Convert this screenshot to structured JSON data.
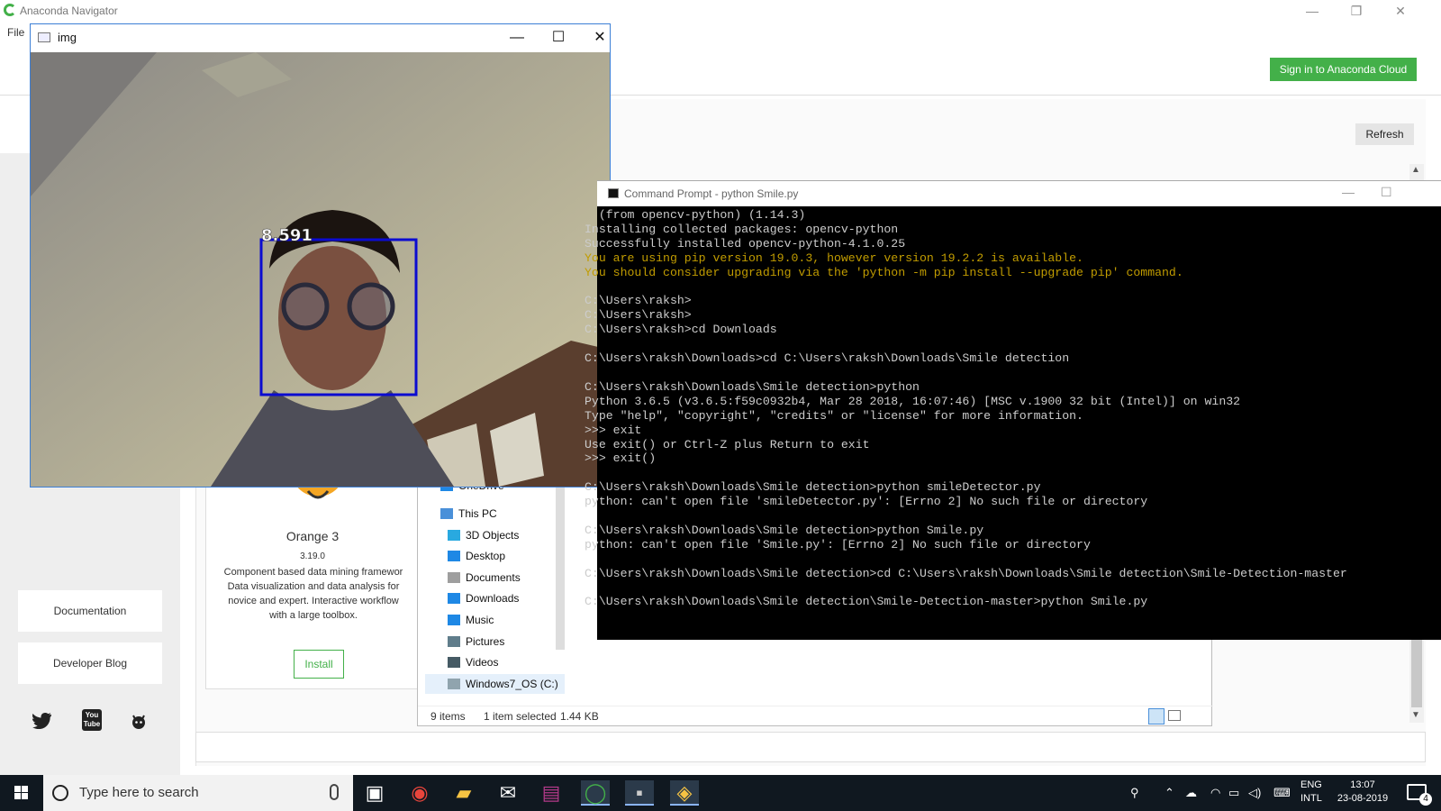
{
  "navigator": {
    "title": "Anaconda Navigator",
    "menu_file": "File",
    "window_controls": [
      "—",
      "❐",
      "✕"
    ],
    "signin_label": "Sign in to Anaconda Cloud",
    "refresh_label": "Refresh",
    "documentation_label": "Documentation",
    "blog_label": "Developer Blog",
    "social_icons": [
      "twitter-icon",
      "youtube-icon",
      "github-icon"
    ],
    "youtube_glyph": "You Tube",
    "app_card": {
      "name": "Orange 3",
      "version": "3.19.0",
      "description": "Component based data mining framewor\nData visualization and data analysis for\nnovice and expert. Interactive workflow\nwith a large toolbox.",
      "install_label": "Install"
    },
    "accent_color": "#43b049"
  },
  "explorer": {
    "nav_items": [
      {
        "label": "OneDrive",
        "icon": "cloud-icon"
      },
      {
        "label": "This PC",
        "icon": "pc-icon"
      },
      {
        "label": "3D Objects",
        "icon": "cube-icon"
      },
      {
        "label": "Desktop",
        "icon": "desktop-icon"
      },
      {
        "label": "Documents",
        "icon": "document-icon"
      },
      {
        "label": "Downloads",
        "icon": "download-icon"
      },
      {
        "label": "Music",
        "icon": "music-icon"
      },
      {
        "label": "Pictures",
        "icon": "pictures-icon"
      },
      {
        "label": "Videos",
        "icon": "videos-icon"
      },
      {
        "label": "Windows7_OS (C:)",
        "icon": "drive-icon"
      }
    ],
    "status_items": "9 items",
    "status_selected": "1 item selected",
    "status_size": "1.44 KB"
  },
  "img_window": {
    "title": "img",
    "score_label": "8.591"
  },
  "cmd_window": {
    "title": "Command Prompt - python  Smile.py",
    "lines": [
      {
        "text": "  (from opencv-python) (1.14.3)",
        "warn": false
      },
      {
        "text": "Installing collected packages: opencv-python",
        "warn": false
      },
      {
        "text": "Successfully installed opencv-python-4.1.0.25",
        "warn": false
      },
      {
        "text": "You are using pip version 19.0.3, however version 19.2.2 is available.",
        "warn": true
      },
      {
        "text": "You should consider upgrading via the 'python -m pip install --upgrade pip' command.",
        "warn": true
      },
      {
        "text": "",
        "warn": false
      },
      {
        "text": "C:\\Users\\raksh>",
        "warn": false
      },
      {
        "text": "C:\\Users\\raksh>",
        "warn": false
      },
      {
        "text": "C:\\Users\\raksh>cd Downloads",
        "warn": false
      },
      {
        "text": "",
        "warn": false
      },
      {
        "text": "C:\\Users\\raksh\\Downloads>cd C:\\Users\\raksh\\Downloads\\Smile detection",
        "warn": false
      },
      {
        "text": "",
        "warn": false
      },
      {
        "text": "C:\\Users\\raksh\\Downloads\\Smile detection>python",
        "warn": false
      },
      {
        "text": "Python 3.6.5 (v3.6.5:f59c0932b4, Mar 28 2018, 16:07:46) [MSC v.1900 32 bit (Intel)] on win32",
        "warn": false
      },
      {
        "text": "Type \"help\", \"copyright\", \"credits\" or \"license\" for more information.",
        "warn": false
      },
      {
        "text": ">>> exit",
        "warn": false
      },
      {
        "text": "Use exit() or Ctrl-Z plus Return to exit",
        "warn": false
      },
      {
        "text": ">>> exit()",
        "warn": false
      },
      {
        "text": "",
        "warn": false
      },
      {
        "text": "C:\\Users\\raksh\\Downloads\\Smile detection>python smileDetector.py",
        "warn": false
      },
      {
        "text": "python: can't open file 'smileDetector.py': [Errno 2] No such file or directory",
        "warn": false
      },
      {
        "text": "",
        "warn": false
      },
      {
        "text": "C:\\Users\\raksh\\Downloads\\Smile detection>python Smile.py",
        "warn": false
      },
      {
        "text": "python: can't open file 'Smile.py': [Errno 2] No such file or directory",
        "warn": false
      },
      {
        "text": "",
        "warn": false
      },
      {
        "text": "C:\\Users\\raksh\\Downloads\\Smile detection>cd C:\\Users\\raksh\\Downloads\\Smile detection\\Smile-Detection-master",
        "warn": false
      },
      {
        "text": "",
        "warn": false
      },
      {
        "text": "C:\\Users\\raksh\\Downloads\\Smile detection\\Smile-Detection-master>python Smile.py",
        "warn": false
      }
    ]
  },
  "taskbar": {
    "search_placeholder": "Type here to search",
    "pinned": [
      "task-view-icon",
      "chrome-icon",
      "file-explorer-icon",
      "mail-icon",
      "winrar-icon",
      "anaconda-icon",
      "cmd-icon",
      "python-icon"
    ],
    "lang_line1": "ENG",
    "lang_line2": "INTL",
    "time": "13:07",
    "date": "23-08-2019",
    "notification_count": "4"
  }
}
